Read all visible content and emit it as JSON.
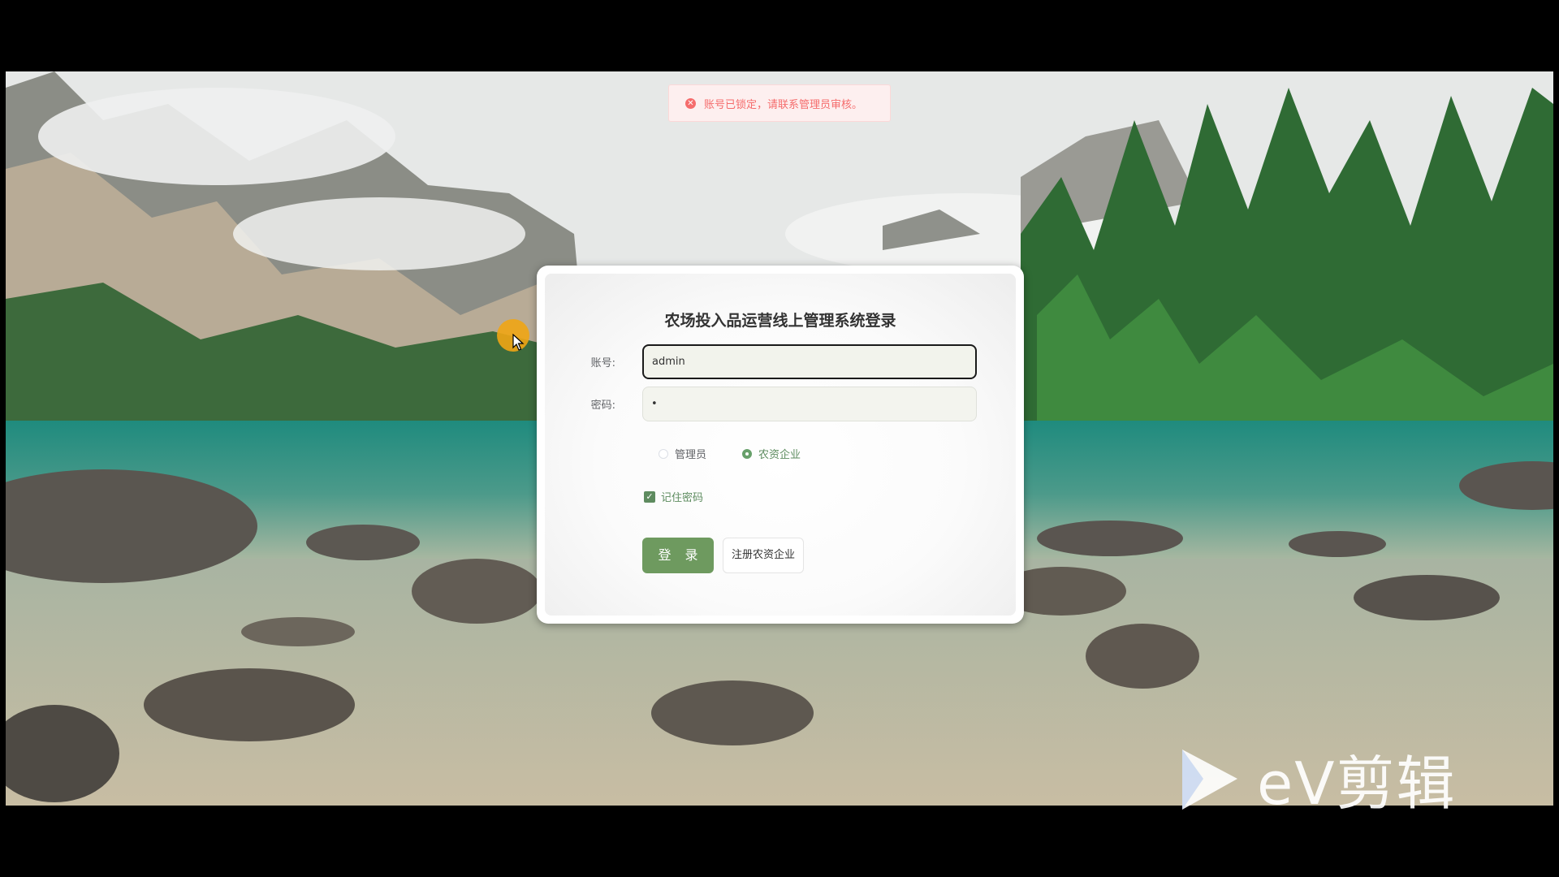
{
  "toast": {
    "icon": "error-icon",
    "message": "账号已锁定，请联系管理员审核。",
    "color": "#f56c6c"
  },
  "login": {
    "title": "农场投入品运营线上管理系统登录",
    "account_label": "账号:",
    "account_value": "admin",
    "password_label": "密码:",
    "password_value": "•",
    "roles": [
      {
        "label": "管理员",
        "checked": false
      },
      {
        "label": "农资企业",
        "checked": true
      }
    ],
    "remember_label": "记住密码",
    "remember_checked": true,
    "login_button": "登 录",
    "register_button": "注册农资企业",
    "accent_color": "#6e9a5f"
  },
  "watermark": {
    "text": "eV剪辑",
    "icon": "play-logo-icon"
  }
}
